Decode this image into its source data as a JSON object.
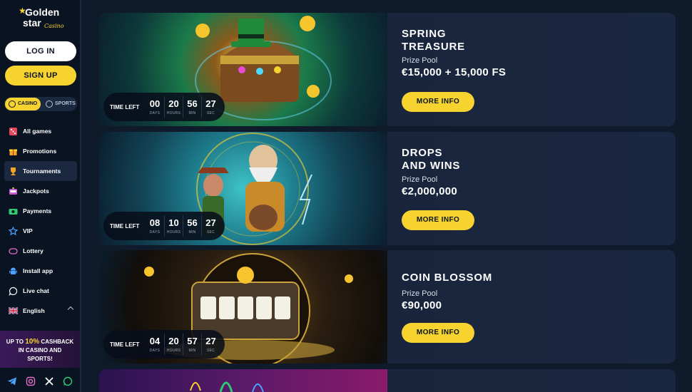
{
  "brand": {
    "line1": "Golden",
    "line2": "star",
    "line3": "Casino"
  },
  "auth": {
    "login_label": "LOG IN",
    "signup_label": "SIGN UP"
  },
  "mode_switch": {
    "casino_label": "CASINO",
    "sports_label": "SPORTS",
    "selected": "CASINO"
  },
  "nav": {
    "items": [
      {
        "label": "All games",
        "icon": "dice-icon"
      },
      {
        "label": "Promotions",
        "icon": "gift-icon"
      },
      {
        "label": "Tournaments",
        "icon": "trophy-icon",
        "active": true
      },
      {
        "label": "Jackpots",
        "icon": "jackpot-icon"
      },
      {
        "label": "Payments",
        "icon": "payment-icon"
      },
      {
        "label": "VIP",
        "icon": "star-icon"
      },
      {
        "label": "Lottery",
        "icon": "ticket-icon"
      },
      {
        "label": "Install app",
        "icon": "android-icon"
      },
      {
        "label": "Live chat",
        "icon": "chat-icon"
      },
      {
        "label": "English",
        "icon": "uk-flag-icon"
      }
    ]
  },
  "cashback_banner": {
    "line1_prefix": "UP TO ",
    "line1_highlight": "10%",
    "line1_suffix": " CASHBACK",
    "line2": "IN CASINO AND",
    "line3": "SPORTS!"
  },
  "social": [
    "telegram-icon",
    "instagram-icon",
    "x-icon",
    "whatsapp-icon"
  ],
  "timer_labels": {
    "title": "TIME LEFT",
    "days": "DAYS",
    "hours": "HOURS",
    "min": "MIN",
    "sec": "SEC"
  },
  "tournaments": [
    {
      "title_line1": "SPRING",
      "title_line2": "TREASURE",
      "prize_label": "Prize Pool",
      "prize_value": "€15,000 + 15,000 FS",
      "button": "MORE INFO",
      "timer": {
        "days": "00",
        "hours": "20",
        "min": "56",
        "sec": "27"
      }
    },
    {
      "title_line1": "DROPS",
      "title_line2": "AND WINS",
      "prize_label": "Prize Pool",
      "prize_value": "€2,000,000",
      "button": "MORE INFO",
      "timer": {
        "days": "08",
        "hours": "10",
        "min": "56",
        "sec": "27"
      }
    },
    {
      "title_line1": "COIN BLOSSOM",
      "title_line2": "",
      "prize_label": "Prize Pool",
      "prize_value": "€90,000",
      "button": "MORE INFO",
      "timer": {
        "days": "04",
        "hours": "20",
        "min": "57",
        "sec": "27"
      }
    }
  ],
  "colors": {
    "accent": "#f6d32e",
    "background": "#0f1a2b",
    "sidebar": "#0a1322",
    "card": "#172339"
  }
}
